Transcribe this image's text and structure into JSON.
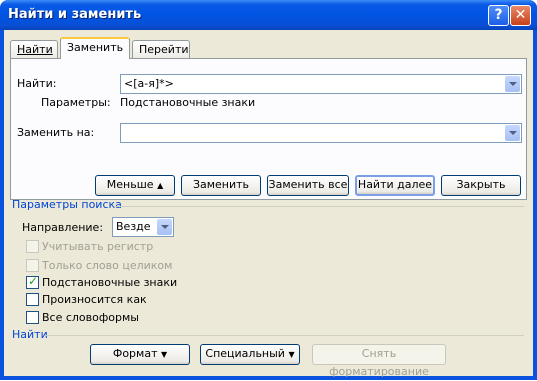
{
  "window": {
    "title": "Найти и заменить",
    "help": "?",
    "close": "✕"
  },
  "tabs": [
    {
      "label": "Найти",
      "active": false
    },
    {
      "label": "Заменить",
      "active": true
    },
    {
      "label": "Перейти",
      "active": false
    }
  ],
  "find": {
    "label": "Найти:",
    "value": "<[а-я]*>"
  },
  "params": {
    "label": "Параметры:",
    "value": "Подстановочные знаки"
  },
  "replace": {
    "label": "Заменить на:",
    "value": ""
  },
  "buttons": {
    "less": "Меньше",
    "replace": "Заменить",
    "replace_all": "Заменить все",
    "find_next": "Найти далее",
    "close": "Закрыть"
  },
  "search_options": {
    "title": "Параметры поиска",
    "direction_label": "Направление:",
    "direction_value": "Везде",
    "checkboxes": [
      {
        "label": "Учитывать регистр",
        "checked": false,
        "enabled": false
      },
      {
        "label": "Только слово целиком",
        "checked": false,
        "enabled": false
      },
      {
        "label": "Подстановочные знаки",
        "checked": true,
        "enabled": true
      },
      {
        "label": "Произносится как",
        "checked": false,
        "enabled": true
      },
      {
        "label": "Все словоформы",
        "checked": false,
        "enabled": true
      }
    ]
  },
  "find_section": {
    "title": "Найти",
    "format": "Формат",
    "special": "Специальный",
    "clear_format": "Снять форматирование"
  },
  "colors": {
    "title_bar": "#0054e3",
    "dialog_bg": "#ece9d8",
    "section_text": "#0046d5"
  }
}
